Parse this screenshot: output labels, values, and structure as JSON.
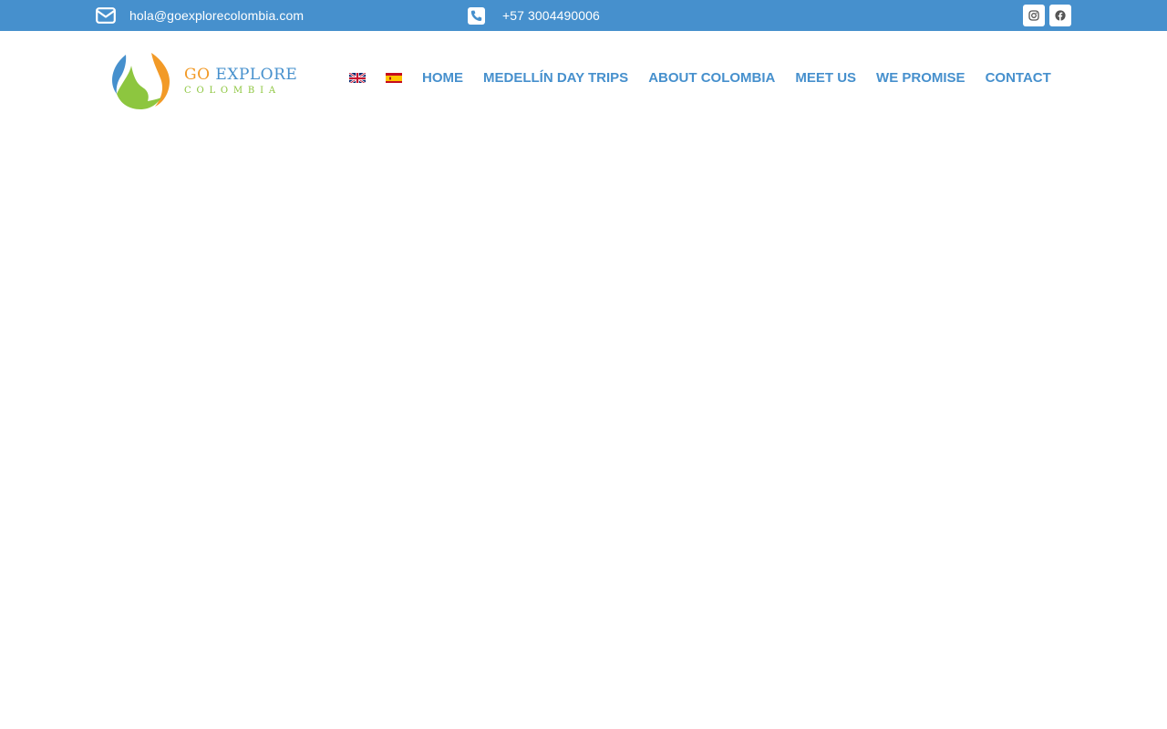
{
  "topbar": {
    "email": "hola@goexplorecolombia.com",
    "email_icon": "envelope-icon",
    "phone": "+57 3004490006",
    "phone_icon": "phone-square-icon",
    "social": [
      {
        "name": "instagram-icon"
      },
      {
        "name": "facebook-icon"
      }
    ],
    "background": "#4690cd"
  },
  "logo": {
    "word_go": "GO",
    "word_explore": " EXPLORE",
    "subtitle": "COLOMBIA",
    "colors": {
      "blue": "#4690cd",
      "orange": "#f29a27",
      "green": "#8dc63f"
    }
  },
  "languages": [
    {
      "code": "en",
      "icon": "uk-flag-icon"
    },
    {
      "code": "es",
      "icon": "spain-flag-icon"
    }
  ],
  "nav": {
    "items": [
      {
        "label": "HOME"
      },
      {
        "label": "MEDELLÍN DAY TRIPS"
      },
      {
        "label": "ABOUT COLOMBIA"
      },
      {
        "label": "MEET US"
      },
      {
        "label": "WE PROMISE"
      },
      {
        "label": "CONTACT"
      }
    ],
    "color": "#4690cd"
  }
}
